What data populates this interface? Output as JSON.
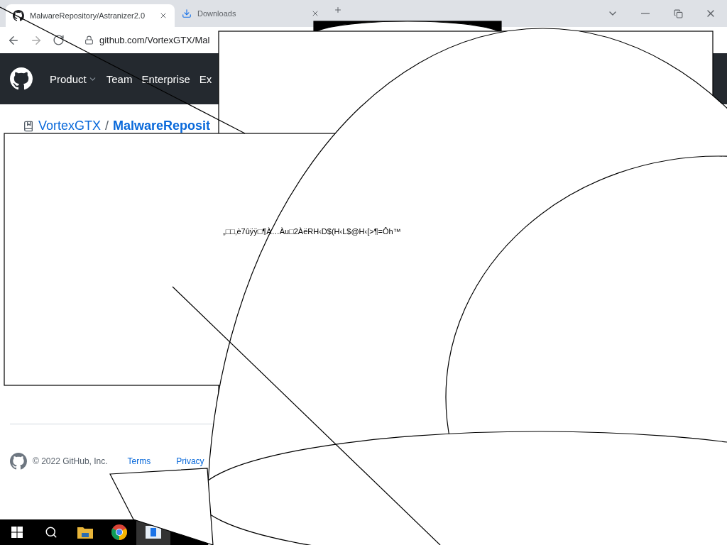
{
  "browser": {
    "tabs": [
      {
        "title": "MalwareRepository/Astranizer2.0",
        "selected": true
      },
      {
        "title": "Downloads",
        "selected": false
      }
    ],
    "address": "github.com/VortexGTX/Mal"
  },
  "nav": {
    "items": [
      {
        "label": "Product",
        "dropdown": true
      },
      {
        "label": "Team",
        "dropdown": false
      },
      {
        "label": "Enterprise",
        "dropdown": false
      },
      {
        "label": "Ex",
        "dropdown": false
      }
    ]
  },
  "repo": {
    "owner": "VortexGTX",
    "separator": "/",
    "name": "MalwareReposit"
  },
  "overlay": {
    "text": "„□□‚è7ûÿÿ□¶À…Àu□2ÀëRH‹D$(H‹L$@H‹[>¶=Ôh™"
  },
  "footer": {
    "copyright": "© 2022 GitHub, Inc.",
    "links": [
      "Terms",
      "Privacy"
    ]
  },
  "taskbar": {
    "apps": [
      {
        "kind": "start",
        "selected": false
      },
      {
        "kind": "search",
        "selected": false
      },
      {
        "kind": "explorer",
        "selected": false
      },
      {
        "kind": "chrome",
        "selected": false
      },
      {
        "kind": "app",
        "selected": true
      }
    ]
  }
}
